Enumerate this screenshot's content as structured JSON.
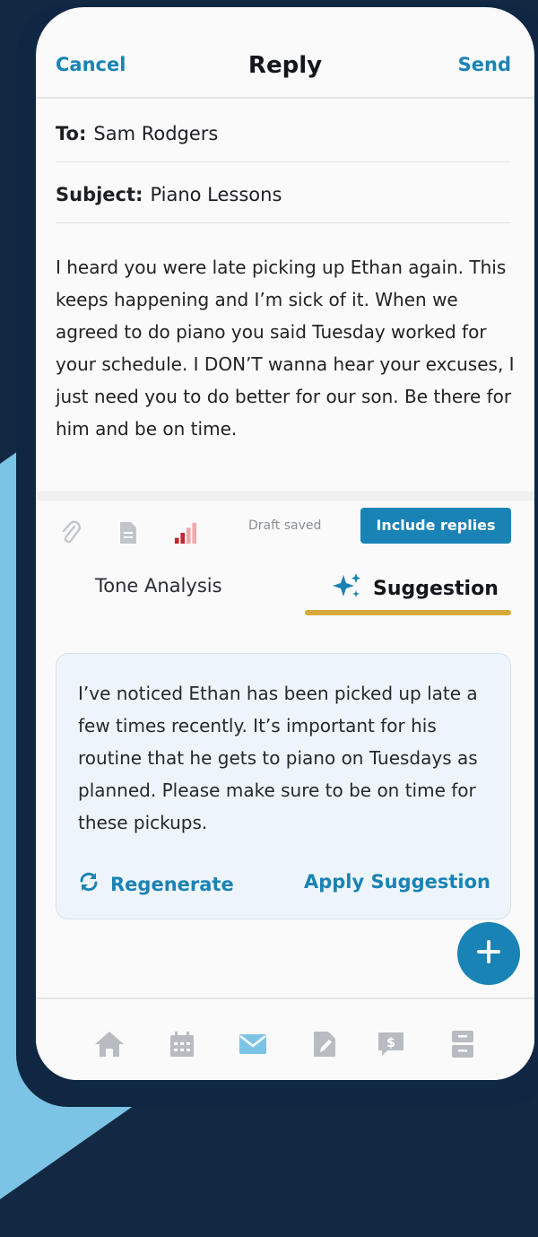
{
  "header": {
    "cancel": "Cancel",
    "title": "Reply",
    "send": "Send"
  },
  "fields": {
    "to_label": "To:",
    "to_value": "Sam Rodgers",
    "subject_label": "Subject:",
    "subject_value": "Piano Lessons"
  },
  "message_body": "I heard you were late picking up Ethan again. This keeps happening and I’m sick of it. When we agreed to do piano you said Tuesday worked for your schedule. I DON’T wanna hear your excuses, I just need you to do better for our son. Be there for him and be on time.",
  "toolbar": {
    "icons": [
      "paperclip-icon",
      "document-icon",
      "tone-meter-icon"
    ],
    "draft_status": "Draft saved",
    "include_replies": "Include replies"
  },
  "tabs": [
    {
      "label": "Tone Analysis",
      "active": false
    },
    {
      "label": "Suggestion",
      "active": true
    }
  ],
  "suggestion": {
    "text": "I’ve noticed Ethan has been picked up late a few times recently. It’s important for his routine that he gets to piano on Tuesdays as planned. Please make sure to be on time for these pickups.",
    "regenerate": "Regenerate",
    "apply": "Apply Suggestion"
  },
  "bottom_nav": [
    "home-icon",
    "calendar-icon",
    "messages-icon",
    "journal-icon",
    "expenses-icon",
    "info-bank-icon"
  ],
  "colors": {
    "accent": "#1a83b5",
    "tab_underline": "#d6a93a",
    "tone_meter": "#c0272d",
    "nav_icon": "#b8bcc2"
  }
}
